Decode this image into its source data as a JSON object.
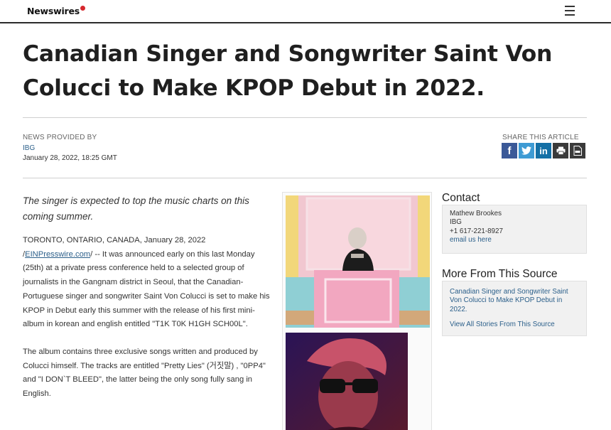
{
  "header": {
    "logo_text": "Newswires"
  },
  "article": {
    "title": "Canadian Singer and Songwriter Saint Von Colucci to Make KPOP Debut in 2022.",
    "news_provided_label": "NEWS PROVIDED BY",
    "provider": "IBG",
    "date": "January 28, 2022, 18:25 GMT",
    "share_label": "SHARE THIS ARTICLE",
    "share_icons": [
      "facebook-icon",
      "twitter-icon",
      "linkedin-icon",
      "print-icon",
      "pdf-icon"
    ],
    "lede": "The singer is expected to top the music charts on this coming summer.",
    "para1_prefix": "TORONTO, ONTARIO, CANADA, January 28, 2022 /",
    "para1_link": "EINPresswire.com",
    "para1_body": "/ -- It was announced early on this last Monday (25th) at a private press conference held to a selected group of journalists in the Gangnam district in Seoul, that the Canadian-Portuguese singer and songwriter Saint Von Colucci is set to make his KPOP in Debut early this summer with the release of his first mini-album in korean and english entitled \"T1K T0K H1GH SCH00L\".",
    "para2": "The album contains three exclusive songs written and produced by Colucci himself. The tracks are entitled \"Pretty Lies\" (거짓말) , \"0PP4\" and \"I DON`T BLEED\", the latter being the only song fully sang in English."
  },
  "sidebar": {
    "contact_heading": "Contact",
    "contact_name": "Mathew Brookes",
    "contact_org": "IBG",
    "contact_phone": "+1 617-221-8927",
    "contact_email_link": "email us here",
    "more_heading": "More From This Source",
    "more_story": "Canadian Singer and Songwriter Saint Von Colucci to Make KPOP Debut in 2022.",
    "view_all": "View All Stories From This Source"
  },
  "colors": {
    "link": "#2b5f8a",
    "facebook": "#3b5998",
    "twitter": "#3e9bd4",
    "linkedin": "#1470a6",
    "logo_accent": "#d6282d"
  }
}
